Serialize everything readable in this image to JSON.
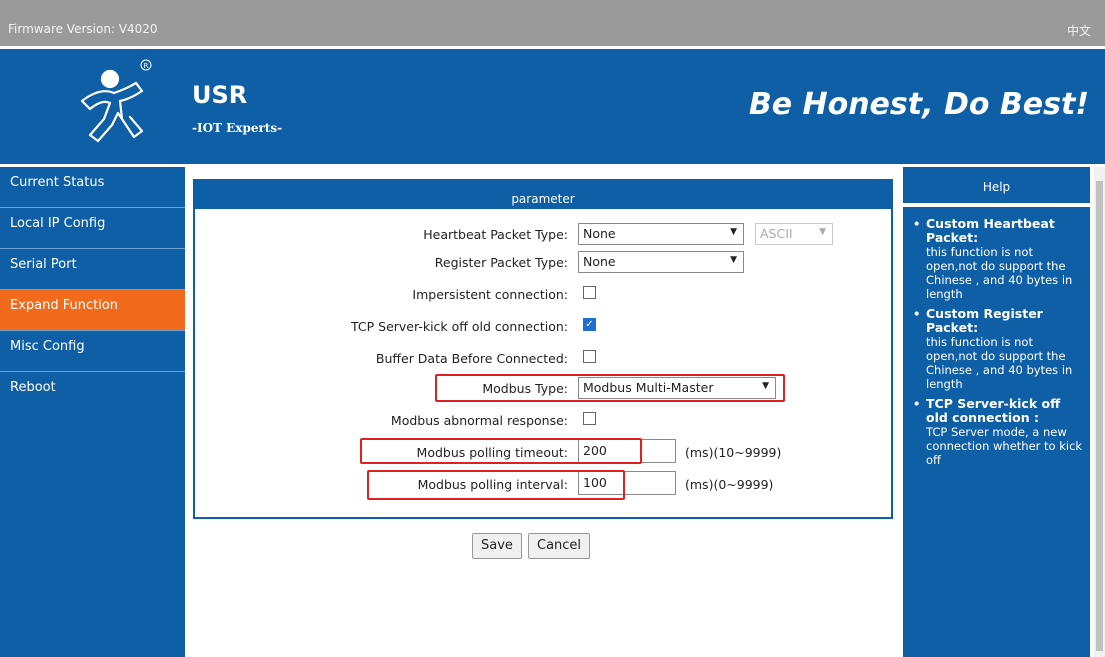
{
  "topbar": {
    "firmware_label": "Firmware Version:",
    "firmware_value": "V4020",
    "language": "中文"
  },
  "header": {
    "brand": "USR",
    "tagline": "-IOT Experts-",
    "slogan": "Be Honest, Do Best!"
  },
  "sidebar": {
    "items": [
      {
        "label": "Current Status",
        "active": false
      },
      {
        "label": "Local IP Config",
        "active": false
      },
      {
        "label": "Serial Port",
        "active": false
      },
      {
        "label": "Expand Function",
        "active": true
      },
      {
        "label": "Misc Config",
        "active": false
      },
      {
        "label": "Reboot",
        "active": false
      }
    ]
  },
  "panel": {
    "title": "parameter",
    "heartbeat_type_label": "Heartbeat Packet Type:",
    "heartbeat_type_value": "None",
    "heartbeat_format_value": "ASCII",
    "register_type_label": "Register Packet Type:",
    "register_type_value": "None",
    "impersistent_label": "Impersistent connection:",
    "impersistent_checked": false,
    "kick_off_label": "TCP Server-kick off old connection:",
    "kick_off_checked": true,
    "buffer_label": "Buffer Data Before Connected:",
    "buffer_checked": false,
    "modbus_type_label": "Modbus Type:",
    "modbus_type_value": "Modbus Multi-Master",
    "modbus_abnormal_label": "Modbus abnormal response:",
    "modbus_abnormal_checked": false,
    "polling_timeout_label": "Modbus polling timeout:",
    "polling_timeout_value": "200",
    "polling_timeout_unit": "(ms)(10~9999)",
    "polling_interval_label": "Modbus polling interval:",
    "polling_interval_value": "100",
    "polling_interval_unit": "(ms)(0~9999)"
  },
  "buttons": {
    "save": "Save",
    "cancel": "Cancel"
  },
  "help": {
    "title": "Help",
    "items": [
      {
        "title": "Custom Heartbeat Packet:",
        "text": "this function is not open,not do support the Chinese , and 40 bytes in length"
      },
      {
        "title": "Custom Register Packet:",
        "text": "this function is not open,not do support the Chinese , and 40 bytes in length"
      },
      {
        "title": "TCP Server-kick off old connection :",
        "text": "TCP Server mode, a new connection whether to kick off"
      }
    ]
  },
  "colors": {
    "header_blue": "#0f5fa6",
    "active_orange": "#f26b1d",
    "highlight_red": "#e02020",
    "topbar_gray": "#9a9a9a"
  }
}
